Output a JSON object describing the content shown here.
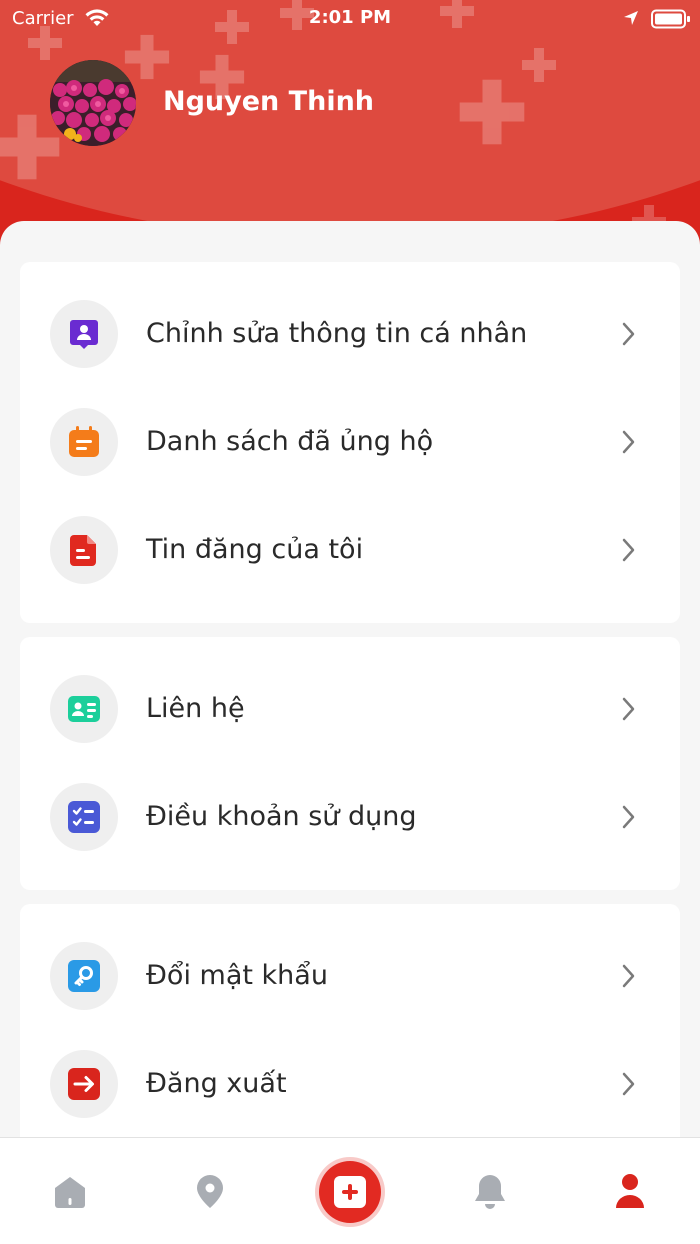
{
  "status_bar": {
    "carrier": "Carrier",
    "time": "2:01 PM"
  },
  "profile": {
    "name": "Nguyen Thinh"
  },
  "menu_groups": [
    {
      "items": [
        {
          "label": "Chỉnh sửa thông tin cá nhân",
          "icon": "user-profile-icon",
          "color": "#6a2bd1"
        },
        {
          "label": "Danh sách đã ủng hộ",
          "icon": "calendar-list-icon",
          "color": "#f47c1a"
        },
        {
          "label": "Tin đăng của tôi",
          "icon": "document-icon",
          "color": "#e0291f"
        }
      ]
    },
    {
      "items": [
        {
          "label": "Liên hệ",
          "icon": "contact-card-icon",
          "color": "#1ccf9b"
        },
        {
          "label": "Điều khoản sử dụng",
          "icon": "checklist-icon",
          "color": "#4a59d6"
        }
      ]
    },
    {
      "items": [
        {
          "label": "Đổi mật khẩu",
          "icon": "key-icon",
          "color": "#2a9ae6"
        },
        {
          "label": "Đăng xuất",
          "icon": "logout-icon",
          "color": "#d9251d"
        }
      ]
    }
  ],
  "tabbar": {
    "tabs": [
      {
        "icon": "home-icon",
        "active": false
      },
      {
        "icon": "map-pin-icon",
        "active": false
      },
      {
        "icon": "add-post-icon",
        "active": false
      },
      {
        "icon": "bell-icon",
        "active": false
      },
      {
        "icon": "profile-icon",
        "active": true
      }
    ]
  },
  "colors": {
    "brand_red": "#d9251d",
    "inactive_icon": "#a9adb3",
    "chevron": "#7a7a7a"
  }
}
